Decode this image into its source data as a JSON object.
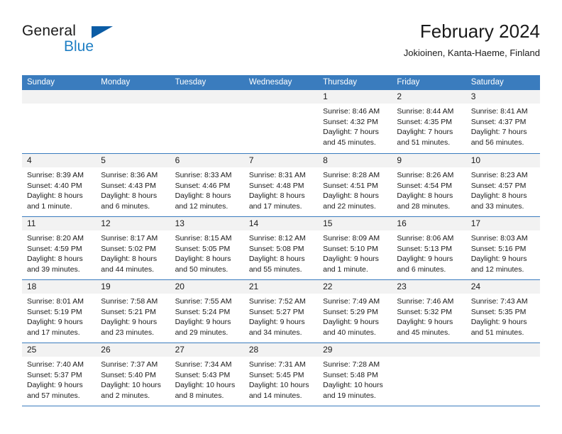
{
  "brand": {
    "name_part1": "General",
    "name_part2": "Blue",
    "logo_icon": "triangle-logo-icon",
    "accent_color": "#1f7fc4",
    "logo_color": "#0b5ca5"
  },
  "header": {
    "title": "February 2024",
    "location": "Jokioinen, Kanta-Haeme, Finland"
  },
  "calendar": {
    "header_bg_color": "#3a7cbe",
    "daynum_band_color": "#f2f2f2",
    "weekday_headers": [
      "Sunday",
      "Monday",
      "Tuesday",
      "Wednesday",
      "Thursday",
      "Friday",
      "Saturday"
    ],
    "weeks": [
      [
        {
          "day": "",
          "lines": []
        },
        {
          "day": "",
          "lines": []
        },
        {
          "day": "",
          "lines": []
        },
        {
          "day": "",
          "lines": []
        },
        {
          "day": "1",
          "lines": [
            "Sunrise: 8:46 AM",
            "Sunset: 4:32 PM",
            "Daylight: 7 hours",
            "and 45 minutes."
          ]
        },
        {
          "day": "2",
          "lines": [
            "Sunrise: 8:44 AM",
            "Sunset: 4:35 PM",
            "Daylight: 7 hours",
            "and 51 minutes."
          ]
        },
        {
          "day": "3",
          "lines": [
            "Sunrise: 8:41 AM",
            "Sunset: 4:37 PM",
            "Daylight: 7 hours",
            "and 56 minutes."
          ]
        }
      ],
      [
        {
          "day": "4",
          "lines": [
            "Sunrise: 8:39 AM",
            "Sunset: 4:40 PM",
            "Daylight: 8 hours",
            "and 1 minute."
          ]
        },
        {
          "day": "5",
          "lines": [
            "Sunrise: 8:36 AM",
            "Sunset: 4:43 PM",
            "Daylight: 8 hours",
            "and 6 minutes."
          ]
        },
        {
          "day": "6",
          "lines": [
            "Sunrise: 8:33 AM",
            "Sunset: 4:46 PM",
            "Daylight: 8 hours",
            "and 12 minutes."
          ]
        },
        {
          "day": "7",
          "lines": [
            "Sunrise: 8:31 AM",
            "Sunset: 4:48 PM",
            "Daylight: 8 hours",
            "and 17 minutes."
          ]
        },
        {
          "day": "8",
          "lines": [
            "Sunrise: 8:28 AM",
            "Sunset: 4:51 PM",
            "Daylight: 8 hours",
            "and 22 minutes."
          ]
        },
        {
          "day": "9",
          "lines": [
            "Sunrise: 8:26 AM",
            "Sunset: 4:54 PM",
            "Daylight: 8 hours",
            "and 28 minutes."
          ]
        },
        {
          "day": "10",
          "lines": [
            "Sunrise: 8:23 AM",
            "Sunset: 4:57 PM",
            "Daylight: 8 hours",
            "and 33 minutes."
          ]
        }
      ],
      [
        {
          "day": "11",
          "lines": [
            "Sunrise: 8:20 AM",
            "Sunset: 4:59 PM",
            "Daylight: 8 hours",
            "and 39 minutes."
          ]
        },
        {
          "day": "12",
          "lines": [
            "Sunrise: 8:17 AM",
            "Sunset: 5:02 PM",
            "Daylight: 8 hours",
            "and 44 minutes."
          ]
        },
        {
          "day": "13",
          "lines": [
            "Sunrise: 8:15 AM",
            "Sunset: 5:05 PM",
            "Daylight: 8 hours",
            "and 50 minutes."
          ]
        },
        {
          "day": "14",
          "lines": [
            "Sunrise: 8:12 AM",
            "Sunset: 5:08 PM",
            "Daylight: 8 hours",
            "and 55 minutes."
          ]
        },
        {
          "day": "15",
          "lines": [
            "Sunrise: 8:09 AM",
            "Sunset: 5:10 PM",
            "Daylight: 9 hours",
            "and 1 minute."
          ]
        },
        {
          "day": "16",
          "lines": [
            "Sunrise: 8:06 AM",
            "Sunset: 5:13 PM",
            "Daylight: 9 hours",
            "and 6 minutes."
          ]
        },
        {
          "day": "17",
          "lines": [
            "Sunrise: 8:03 AM",
            "Sunset: 5:16 PM",
            "Daylight: 9 hours",
            "and 12 minutes."
          ]
        }
      ],
      [
        {
          "day": "18",
          "lines": [
            "Sunrise: 8:01 AM",
            "Sunset: 5:19 PM",
            "Daylight: 9 hours",
            "and 17 minutes."
          ]
        },
        {
          "day": "19",
          "lines": [
            "Sunrise: 7:58 AM",
            "Sunset: 5:21 PM",
            "Daylight: 9 hours",
            "and 23 minutes."
          ]
        },
        {
          "day": "20",
          "lines": [
            "Sunrise: 7:55 AM",
            "Sunset: 5:24 PM",
            "Daylight: 9 hours",
            "and 29 minutes."
          ]
        },
        {
          "day": "21",
          "lines": [
            "Sunrise: 7:52 AM",
            "Sunset: 5:27 PM",
            "Daylight: 9 hours",
            "and 34 minutes."
          ]
        },
        {
          "day": "22",
          "lines": [
            "Sunrise: 7:49 AM",
            "Sunset: 5:29 PM",
            "Daylight: 9 hours",
            "and 40 minutes."
          ]
        },
        {
          "day": "23",
          "lines": [
            "Sunrise: 7:46 AM",
            "Sunset: 5:32 PM",
            "Daylight: 9 hours",
            "and 45 minutes."
          ]
        },
        {
          "day": "24",
          "lines": [
            "Sunrise: 7:43 AM",
            "Sunset: 5:35 PM",
            "Daylight: 9 hours",
            "and 51 minutes."
          ]
        }
      ],
      [
        {
          "day": "25",
          "lines": [
            "Sunrise: 7:40 AM",
            "Sunset: 5:37 PM",
            "Daylight: 9 hours",
            "and 57 minutes."
          ]
        },
        {
          "day": "26",
          "lines": [
            "Sunrise: 7:37 AM",
            "Sunset: 5:40 PM",
            "Daylight: 10 hours",
            "and 2 minutes."
          ]
        },
        {
          "day": "27",
          "lines": [
            "Sunrise: 7:34 AM",
            "Sunset: 5:43 PM",
            "Daylight: 10 hours",
            "and 8 minutes."
          ]
        },
        {
          "day": "28",
          "lines": [
            "Sunrise: 7:31 AM",
            "Sunset: 5:45 PM",
            "Daylight: 10 hours",
            "and 14 minutes."
          ]
        },
        {
          "day": "29",
          "lines": [
            "Sunrise: 7:28 AM",
            "Sunset: 5:48 PM",
            "Daylight: 10 hours",
            "and 19 minutes."
          ]
        },
        {
          "day": "",
          "lines": []
        },
        {
          "day": "",
          "lines": []
        }
      ]
    ]
  }
}
